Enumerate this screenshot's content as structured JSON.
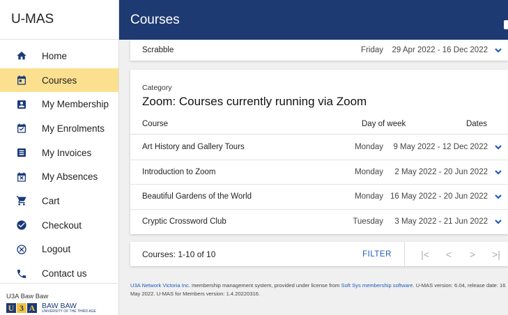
{
  "app": {
    "name": "U-MAS"
  },
  "header": {
    "title": "Courses"
  },
  "sidebar": {
    "items": [
      {
        "label": "Home",
        "icon": "home-icon"
      },
      {
        "label": "Courses",
        "icon": "calendar-icon"
      },
      {
        "label": "My Membership",
        "icon": "badge-icon"
      },
      {
        "label": "My Enrolments",
        "icon": "calendar-check-icon"
      },
      {
        "label": "My Invoices",
        "icon": "list-icon"
      },
      {
        "label": "My Absences",
        "icon": "calendar-x-icon"
      },
      {
        "label": "Cart",
        "icon": "cart-icon"
      },
      {
        "label": "Checkout",
        "icon": "check-circle-icon"
      },
      {
        "label": "Logout",
        "icon": "x-circle-icon"
      },
      {
        "label": "Contact us",
        "icon": "phone-icon"
      }
    ],
    "active_index": 1,
    "footer": {
      "org": "U3A Baw Baw",
      "logo_letters": [
        "U",
        "3",
        "A"
      ],
      "logo_name": "BAW BAW",
      "logo_tagline": "UNIVERSITY OF THE THIRD AGE"
    }
  },
  "previous_row": {
    "course": "Scrabble",
    "day": "Friday",
    "dates": "29 Apr 2022 - 16 Dec 2022"
  },
  "category": {
    "label": "Category",
    "title": "Zoom: Courses currently running via Zoom",
    "columns": {
      "course": "Course",
      "day": "Day of week",
      "dates": "Dates"
    },
    "rows": [
      {
        "course": "Art History and Gallery Tours",
        "day": "Monday",
        "dates": "9 May 2022 - 12 Dec 2022"
      },
      {
        "course": "Introduction to Zoom",
        "day": "Monday",
        "dates": "2 May 2022 - 20 Jun 2022"
      },
      {
        "course": "Beautiful Gardens of the World",
        "day": "Monday",
        "dates": "16 May 2022 - 20 Jun 2022"
      },
      {
        "course": "Cryptic Crossword Club",
        "day": "Tuesday",
        "dates": "3 May 2022 - 21 Jun 2022"
      }
    ]
  },
  "pager": {
    "count": "Courses: 1-10 of 10",
    "filter": "FILTER",
    "first": "|<",
    "prev": "<",
    "next": ">",
    "last": ">|"
  },
  "footer": {
    "link1": "U3A Network Victoria Inc.",
    "text1": " membership management system, provided under license from ",
    "link2": "Soft Sys membership software",
    "text2": ". U-MAS version: 6.04, release date: 16 May 2022. U-MAS for Members version: 1.4.20220316."
  },
  "colors": {
    "appbar": "#1e3a72",
    "active_nav": "#fbe08f",
    "icon": "#1a3a7a",
    "link": "#1e5bb8"
  }
}
